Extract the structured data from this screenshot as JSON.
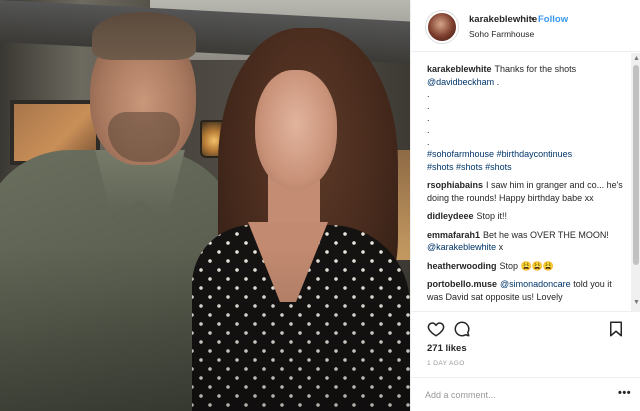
{
  "post": {
    "username": "karakeblewhite",
    "separator": "•",
    "follow_label": "Follow",
    "location": "Soho Farmhouse"
  },
  "caption": {
    "username": "karakeblewhite",
    "text": "Thanks for the shots",
    "mention": "@davidbeckham",
    "mention_suffix": " .",
    "dots": [
      ".",
      ".",
      ".",
      ".",
      "."
    ],
    "hashtags_line1": [
      "#sohofarmhouse",
      "#birthdaycontinues"
    ],
    "hashtags_line2": [
      "#shots",
      "#shots",
      "#shots"
    ]
  },
  "comments": [
    {
      "username": "rsophiabains",
      "text": "I saw him in granger and co... he's doing the rounds! Happy birthday babe xx"
    },
    {
      "username": "didleydeee",
      "text": "Stop it!!"
    },
    {
      "username": "emmafarah1",
      "text": "Bet he was OVER THE MOON!",
      "mention": "@karakeblewhite",
      "suffix": " x"
    },
    {
      "username": "heatherwooding",
      "text": "Stop 😩😩😩"
    },
    {
      "username": "portobello.muse",
      "mention": "@simonadoncare",
      "text": " told you it was David sat opposite us! Lovely"
    }
  ],
  "stats": {
    "likes": "271 likes",
    "time": "1 DAY AGO"
  },
  "composer": {
    "placeholder": "Add a comment...",
    "more_label": "•••"
  },
  "icons": {
    "heart": "heart-icon",
    "comment": "comment-icon",
    "bookmark": "bookmark-icon"
  }
}
